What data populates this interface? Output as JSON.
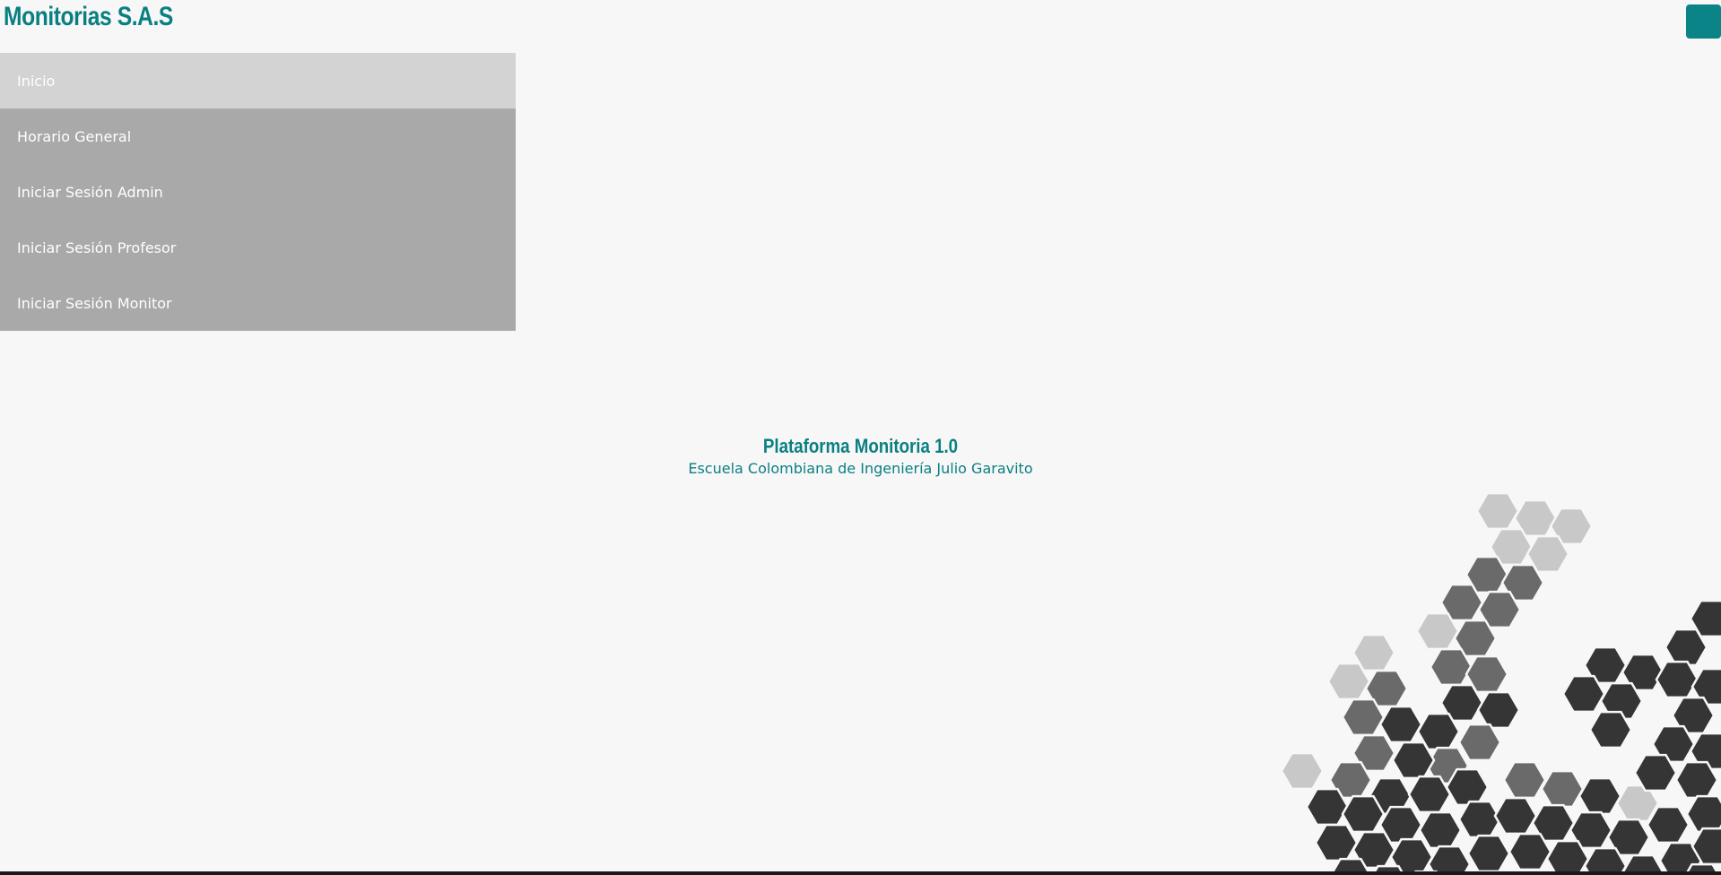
{
  "header": {
    "brand": "Monitorias S.A.S",
    "menu_toggle_icon": "menu-toggle-icon",
    "accent_color": "#0a8486"
  },
  "nav": {
    "items": [
      {
        "label": "Inicio",
        "active": true
      },
      {
        "label": "Horario General",
        "active": false
      },
      {
        "label": "Iniciar Sesión Admin",
        "active": false
      },
      {
        "label": "Iniciar Sesión Profesor",
        "active": false
      },
      {
        "label": "Iniciar Sesión Monitor",
        "active": false
      }
    ]
  },
  "main": {
    "title": "Plataforma Monitoria 1.0",
    "subtitle": "Escuela Colombiana de Ingeniería Julio Garavito"
  },
  "decoration": {
    "name": "hexagon-pattern",
    "colors": {
      "light": "#c8c8c8",
      "mid": "#6a6a6a",
      "dark": "#353535"
    }
  }
}
